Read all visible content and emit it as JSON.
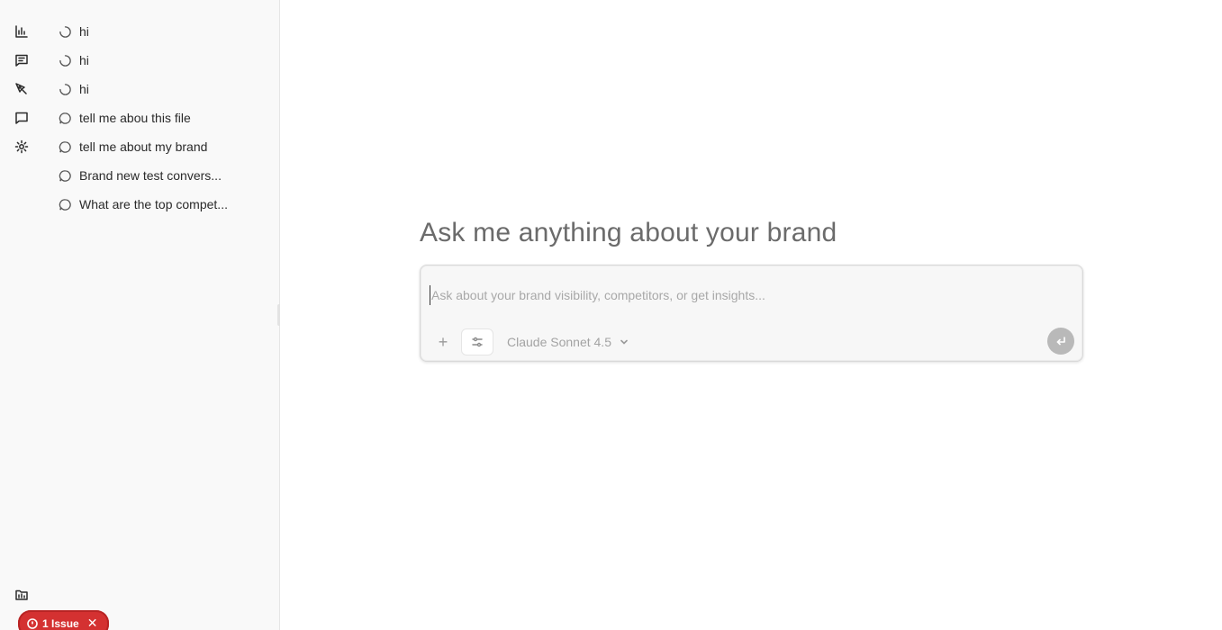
{
  "rail": {
    "items": [
      {
        "icon": "bar-chart-icon"
      },
      {
        "icon": "chat-lines-icon"
      },
      {
        "icon": "pen-tool-icon"
      },
      {
        "icon": "message-square-icon"
      },
      {
        "icon": "gear-icon"
      }
    ],
    "bottom_icon": "folder-icon"
  },
  "conversations": [
    {
      "label": "hi",
      "status": "loading"
    },
    {
      "label": "hi",
      "status": "loading"
    },
    {
      "label": "hi",
      "status": "loading"
    },
    {
      "label": "tell me abou this file",
      "status": "done"
    },
    {
      "label": "tell me about my brand",
      "status": "done"
    },
    {
      "label": "Brand new test convers...",
      "status": "done"
    },
    {
      "label": "What are the top compet...",
      "status": "done"
    }
  ],
  "issue_badge": {
    "label": "1 Issue",
    "color": "#d43131"
  },
  "main": {
    "title": "Ask me anything about your brand",
    "composer": {
      "placeholder": "Ask about your brand visibility, competitors, or get insights...",
      "value": "",
      "model": "Claude Sonnet 4.5"
    }
  }
}
